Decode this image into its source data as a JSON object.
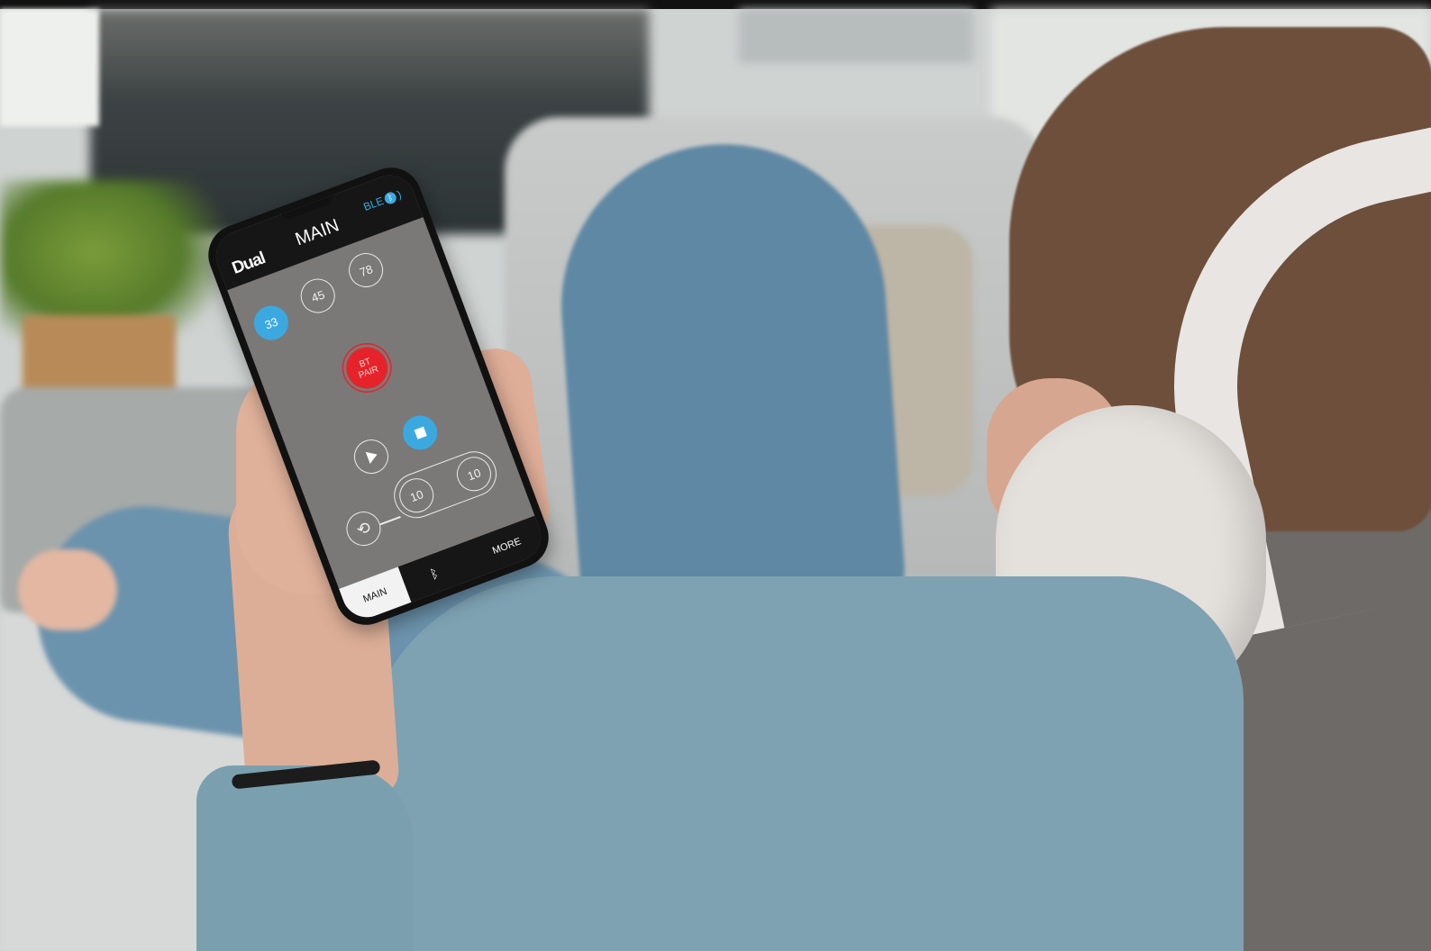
{
  "app": {
    "logo": "Dual",
    "title": "MAIN",
    "ble_label": "BLE",
    "ble_icon": "bluetooth-icon"
  },
  "speeds": [
    {
      "label": "33",
      "selected": true
    },
    {
      "label": "45",
      "selected": false
    },
    {
      "label": "78",
      "selected": false
    }
  ],
  "bt_pair": {
    "line1": "BT",
    "line2": "PAIR"
  },
  "controls": {
    "play_icon": "play-icon",
    "stop_icon": "stop-icon",
    "repeat_icon": "repeat-icon"
  },
  "auto_stop": {
    "left_value": "10",
    "right_value": "10"
  },
  "tabs": [
    {
      "label": "MAIN",
      "active": true
    },
    {
      "label": "",
      "icon": "bluetooth-icon",
      "active": false
    },
    {
      "label": "MORE",
      "active": false
    }
  ],
  "colors": {
    "accent_blue": "#3ba9e0",
    "pair_red": "#e6232a",
    "screen_grey": "#7a7978",
    "header_black": "#161616"
  }
}
